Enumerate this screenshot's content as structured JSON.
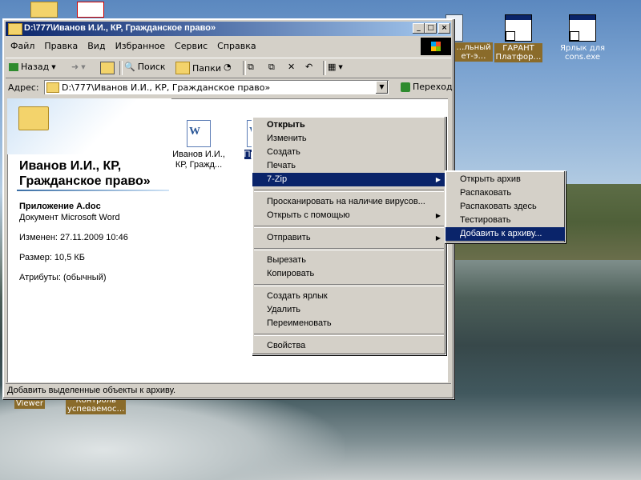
{
  "desktop": {
    "icons": [
      {
        "label": "…льный\nет-э…"
      },
      {
        "label": "ГАРАНТ\nПлатфор…"
      },
      {
        "label": "Ярлык для\ncons.exe"
      },
      {
        "label": "Viewer"
      },
      {
        "label": "Контроль\nуспеваемос…"
      }
    ]
  },
  "window": {
    "title": "D:\\777\\Иванов И.И.,  КР, Гражданское право»",
    "menu": [
      "Файл",
      "Правка",
      "Вид",
      "Избранное",
      "Сервис",
      "Справка"
    ],
    "toolbar": {
      "back": "Назад",
      "search": "Поиск",
      "folders": "Папки"
    },
    "address": {
      "label": "Адрес:",
      "value": "D:\\777\\Иванов И.И.,  КР, Гражданское право»",
      "go": "Переход"
    },
    "panel": {
      "title": "Иванов И.И., КР, Гражданское право»",
      "file_name": "Приложение А.doc",
      "file_type": "Документ Microsoft Word",
      "modified": "Изменен: 27.11.2009 10:46",
      "size": "Размер: 10,5 КБ",
      "attributes": "Атрибуты: (обычный)"
    },
    "files": [
      {
        "name": "Иванов И.И., КР, Гражд..."
      },
      {
        "name": "Прил А"
      }
    ],
    "status": "Добавить выделенные объекты к архиву."
  },
  "context_menu": {
    "items": [
      "Открыть",
      "Изменить",
      "Создать",
      "Печать",
      "7-Zip",
      "Просканировать на наличие вирусов...",
      "Открыть с помощью",
      "Отправить",
      "Вырезать",
      "Копировать",
      "Создать ярлык",
      "Удалить",
      "Переименовать",
      "Свойства"
    ]
  },
  "submenu_7zip": {
    "items": [
      "Открыть архив",
      "Распаковать",
      "Распаковать здесь",
      "Тестировать",
      "Добавить к архиву..."
    ]
  },
  "colors": {
    "selection": "#0a246a",
    "face": "#d4d0c8",
    "title_start": "#0a246a",
    "title_end": "#a6caf0"
  }
}
